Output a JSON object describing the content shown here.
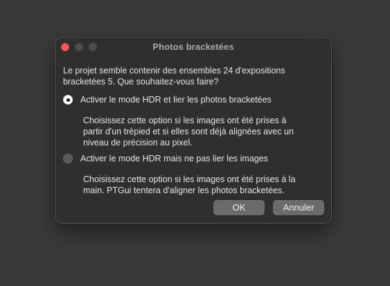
{
  "dialog": {
    "title": "Photos bracketées",
    "question_line1": "Le projet semble contenir des ensembles 24 d'expositions",
    "question_line2": "bracketées 5. Que souhaitez-vous faire?",
    "options": [
      {
        "label": "Activer le mode HDR et lier les photos bracketées",
        "selected": true,
        "desc_line1": "Choisissez cette option si les images ont été prises à",
        "desc_line2": "partir d'un trépied et si elles sont déjà alignées avec un",
        "desc_line3": "niveau de précision au pixel."
      },
      {
        "label": "Activer le mode HDR mais ne pas lier les images",
        "selected": false,
        "desc_line1": "Choisissez cette option si les images ont été prises à la",
        "desc_line2": "main. PTGui tentera d'aligner les photos bracketées."
      }
    ],
    "buttons": {
      "ok": "OK",
      "cancel": "Annuler"
    }
  },
  "colors": {
    "close": "#ec5f58",
    "dialog_bg": "#2f2f31",
    "button_bg": "#6b6b6d"
  }
}
